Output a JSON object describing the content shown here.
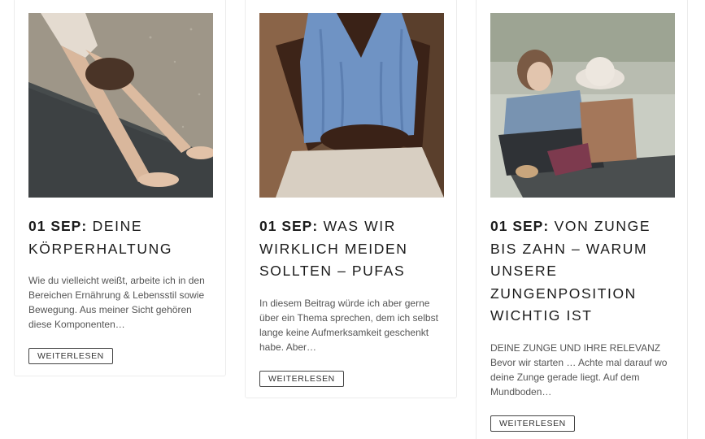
{
  "posts": [
    {
      "date": "01 SEP:",
      "title": "DEINE KÖRPERHALTUNG",
      "excerpt": "Wie du vielleicht weißt, arbeite ich in den Bereichen Ernährung & Lebensstil sowie Bewegung. Aus meiner Sicht gehören diese Komponenten…",
      "button": "WEITERLESEN"
    },
    {
      "date": "01 SEP:",
      "title": "WAS WIR WIRKLICH MEIDEN SOLLTEN – PUFAS",
      "excerpt": "In diesem Beitrag würde ich aber gerne über ein Thema sprechen, dem ich selbst lange keine Aufmerksamkeit geschenkt habe. Aber…",
      "button": "WEITERLESEN"
    },
    {
      "date": "01 SEP:",
      "title": "VON ZUNGE BIS ZAHN – WARUM UNSERE ZUNGENPOSITION WICHTIG IST",
      "excerpt": "DEINE ZUNGE UND IHRE RELEVANZ Bevor wir starten … Achte mal darauf wo deine Zunge gerade liegt. Auf dem Mundboden…",
      "button": "WEITERLESEN"
    }
  ]
}
